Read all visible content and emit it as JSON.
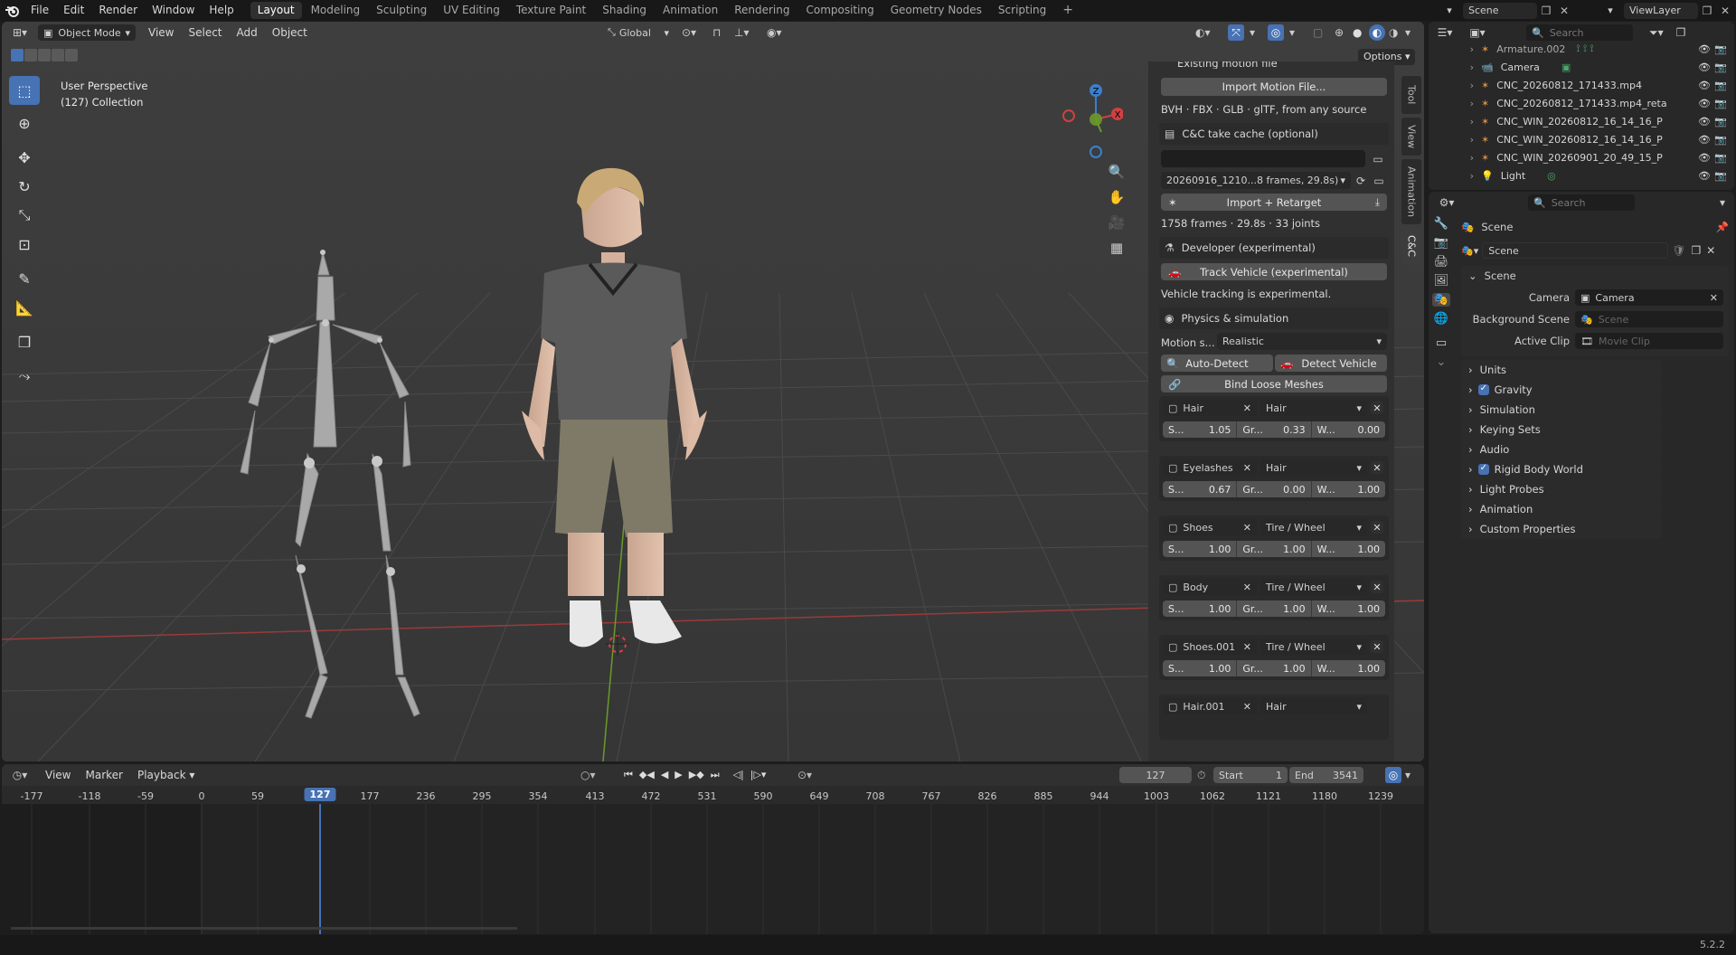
{
  "menubar": {
    "items": [
      "File",
      "Edit",
      "Render",
      "Window",
      "Help"
    ],
    "workspaces": [
      "Layout",
      "Modeling",
      "Sculpting",
      "UV Editing",
      "Texture Paint",
      "Shading",
      "Animation",
      "Rendering",
      "Compositing",
      "Geometry Nodes",
      "Scripting"
    ],
    "scene_name": "Scene",
    "view_layer": "ViewLayer"
  },
  "viewport_header": {
    "mode": "Object Mode",
    "menus": [
      "View",
      "Select",
      "Add",
      "Object"
    ],
    "orientation": "Global",
    "options": "Options"
  },
  "viewport": {
    "perspective": "User Perspective",
    "collection": "(127) Collection",
    "gizmo_axis_z": "Z",
    "gizmo_axis_x": "X"
  },
  "side_tabs": [
    "Tool",
    "View",
    "Animation",
    "C&C"
  ],
  "npanel": {
    "cut_header": "Existing motion file",
    "import_motion_btn": "Import Motion File...",
    "formats_note": "BVH · FBX · GLB · glTF, from any source",
    "take_cache_header": "C&C take cache (optional)",
    "take_path": "",
    "take_selected": "20260916_1210...8 frames, 29.8s)",
    "import_retarget_btn": "Import + Retarget",
    "take_info": "1758 frames · 29.8s · 33 joints",
    "dev_header": "Developer (experimental)",
    "track_vehicle_btn": "Track Vehicle (experimental)",
    "vehicle_note": "Vehicle tracking is experimental.",
    "physics_header": "Physics & simulation",
    "motion_style_label": "Motion s...",
    "motion_style_value": "Realistic",
    "auto_detect_btn": "Auto-Detect",
    "detect_vehicle_btn": "Detect Vehicle",
    "bind_loose_btn": "Bind Loose Meshes",
    "meshes": [
      {
        "name": "Hair",
        "type": "Hair",
        "s": "1.05",
        "gr": "0.33",
        "w": "0.00"
      },
      {
        "name": "Eyelashes",
        "type": "Hair",
        "s": "0.67",
        "gr": "0.00",
        "w": "1.00"
      },
      {
        "name": "Shoes",
        "type": "Tire / Wheel",
        "s": "1.00",
        "gr": "1.00",
        "w": "1.00"
      },
      {
        "name": "Body",
        "type": "Tire / Wheel",
        "s": "1.00",
        "gr": "1.00",
        "w": "1.00"
      },
      {
        "name": "Shoes.001",
        "type": "Tire / Wheel",
        "s": "1.00",
        "gr": "1.00",
        "w": "1.00"
      },
      {
        "name": "Hair.001",
        "type": "Hair"
      }
    ],
    "s_label": "S...",
    "gr_label": "Gr...",
    "w_label": "W..."
  },
  "timeline": {
    "menus": [
      "View",
      "Marker",
      "Playback"
    ],
    "current_frame": "127",
    "start_label": "Start",
    "start": "1",
    "end_label": "End",
    "end": "3541",
    "ruler": [
      "-177",
      "-118",
      "-59",
      "0",
      "59",
      "127",
      "177",
      "236",
      "295",
      "354",
      "413",
      "472",
      "531",
      "590",
      "649",
      "708",
      "767",
      "826",
      "885",
      "944",
      "1003",
      "1062",
      "1121",
      "1180",
      "1239"
    ]
  },
  "outliner": {
    "search_placeholder": "Search",
    "rows": [
      {
        "name": "Armature.002",
        "type": "armature"
      },
      {
        "name": "Camera",
        "type": "camera"
      },
      {
        "name": "CNC_20260812_171433.mp4",
        "type": "armature"
      },
      {
        "name": "CNC_20260812_171433.mp4_reta",
        "type": "armature"
      },
      {
        "name": "CNC_WIN_20260812_16_14_16_P",
        "type": "armature"
      },
      {
        "name": "CNC_WIN_20260812_16_14_16_P",
        "type": "armature"
      },
      {
        "name": "CNC_WIN_20260901_20_49_15_P",
        "type": "armature"
      },
      {
        "name": "Light",
        "type": "light"
      }
    ]
  },
  "properties": {
    "search_placeholder": "Search",
    "context": "Scene",
    "scene_field": "Scene",
    "section": "Scene",
    "camera_label": "Camera",
    "camera_value": "Camera",
    "bg_scene_label": "Background Scene",
    "bg_scene_placeholder": "Scene",
    "active_clip_label": "Active Clip",
    "active_clip_placeholder": "Movie Clip",
    "panels": [
      {
        "label": "Units",
        "checkbox": false
      },
      {
        "label": "Gravity",
        "checkbox": true
      },
      {
        "label": "Simulation",
        "checkbox": false
      },
      {
        "label": "Keying Sets",
        "checkbox": false
      },
      {
        "label": "Audio",
        "checkbox": false
      },
      {
        "label": "Rigid Body World",
        "checkbox": true
      },
      {
        "label": "Light Probes",
        "checkbox": false
      },
      {
        "label": "Animation",
        "checkbox": false
      },
      {
        "label": "Custom Properties",
        "checkbox": false
      }
    ]
  },
  "statusbar": {
    "version": "5.2.2"
  },
  "colors": {
    "accent": "#4772b3",
    "x_axis": "#b03a3a",
    "y_axis": "#6a9a2a",
    "bg_viewport": "#3d3d3d"
  }
}
